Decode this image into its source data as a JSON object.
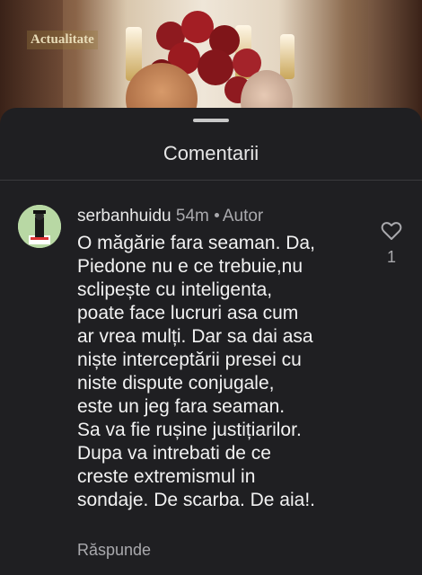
{
  "video": {
    "badge": "Actualitate"
  },
  "sheet": {
    "title": "Comentarii"
  },
  "comment": {
    "username": "serbanhuidu",
    "time": "54m",
    "role": "Autor",
    "body_lines": [
      "O măgărie fara seaman. Da,",
      "Piedone nu e ce trebuie,nu",
      "sclipește cu inteligenta,",
      "poate face lucruri asa cum",
      "ar vrea mulți. Dar sa dai asa",
      "niște interceptării presei cu",
      "niste dispute conjugale,",
      "este un jeg fara seaman.",
      "Sa va fie rușine justițiarilor.",
      "Dupa va intrebati de ce",
      "creste extremismul in",
      "sondaje. De scarba. De aia!."
    ],
    "reply_label": "Răspunde",
    "like_count": "1"
  },
  "colors": {
    "background": "#1f1f22",
    "text": "#f2f2f2",
    "muted": "#a9a9ad",
    "avatar_bg": "#b8d8a4"
  },
  "icons": [
    "heart-outline-icon"
  ]
}
